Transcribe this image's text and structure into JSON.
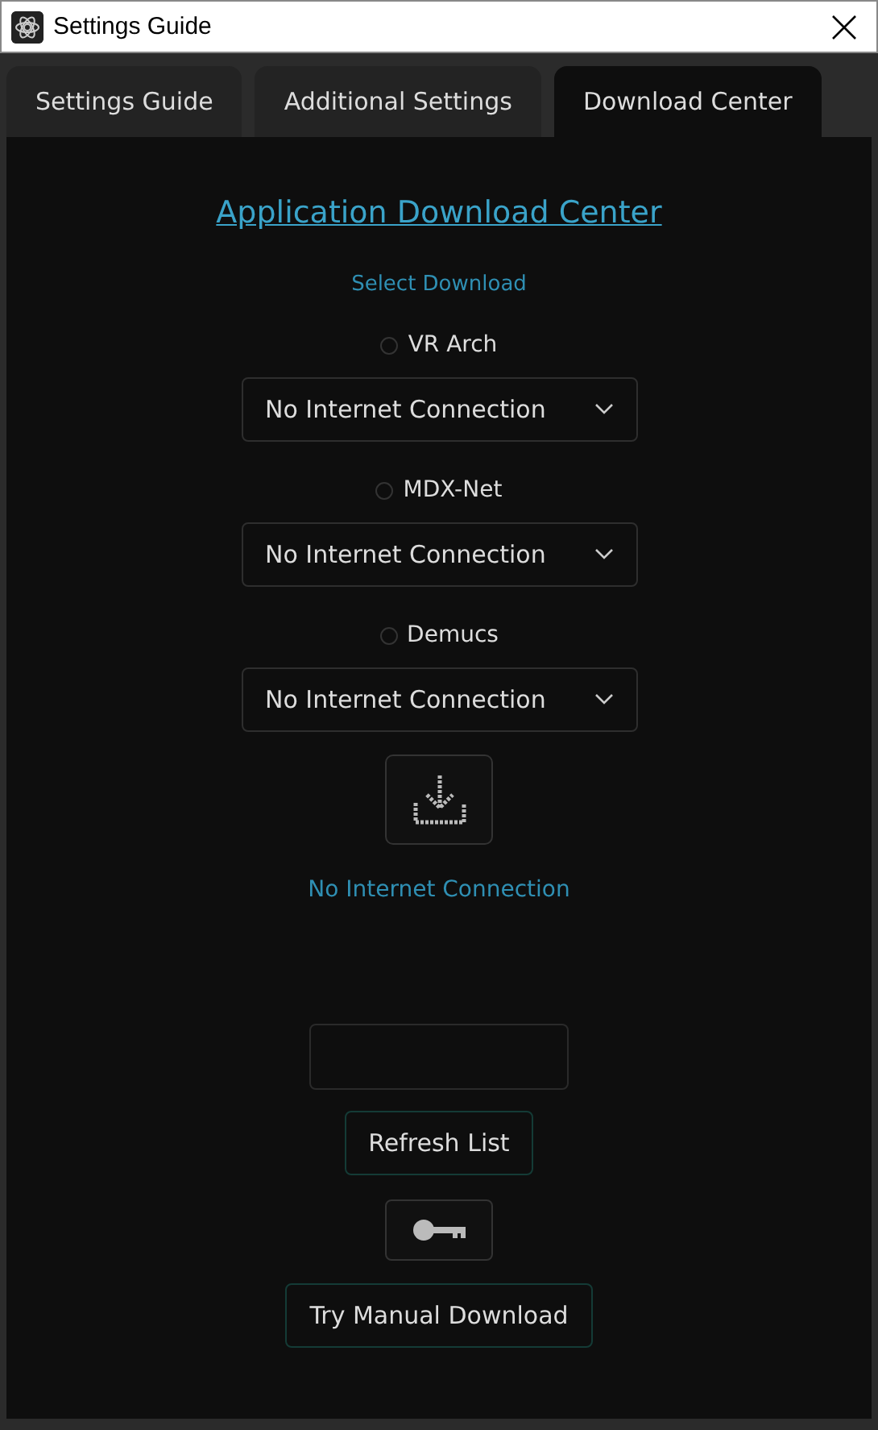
{
  "window": {
    "title": "Settings Guide"
  },
  "tabs": [
    {
      "label": "Settings Guide",
      "selected": false
    },
    {
      "label": "Additional Settings",
      "selected": false
    },
    {
      "label": "Download Center",
      "selected": true
    }
  ],
  "heading": "Application Download Center",
  "select_label": "Select Download",
  "models": [
    {
      "name": "VR Arch",
      "selected": false,
      "dropdown": "No Internet Connection"
    },
    {
      "name": "MDX-Net",
      "selected": false,
      "dropdown": "No Internet Connection"
    },
    {
      "name": "Demucs",
      "selected": false,
      "dropdown": "No Internet Connection"
    }
  ],
  "status": "No Internet Connection",
  "refresh_button": "Refresh List",
  "manual_button": "Try Manual Download"
}
